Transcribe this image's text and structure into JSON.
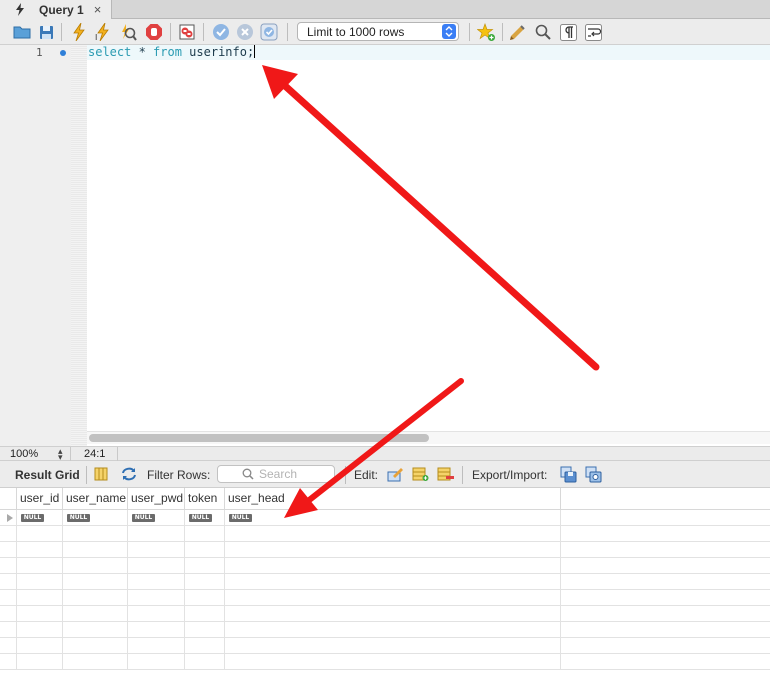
{
  "tab": {
    "title": "Query 1",
    "close_label": "×"
  },
  "toolbar": {
    "icons": [
      "open-folder-icon",
      "save-icon",
      "execute-icon",
      "execute-current-icon",
      "explain-icon",
      "stop-icon",
      "toggle-error-stop-icon",
      "commit-icon",
      "rollback-icon",
      "autocommit-icon",
      "bookmark-icon",
      "beautify-icon",
      "find-icon",
      "invisible-chars-icon",
      "word-wrap-icon"
    ],
    "limit_label": "Limit to 1000 rows"
  },
  "editor": {
    "line_number": "1",
    "tokens": {
      "select": "select",
      "star": " * ",
      "from": "from",
      "table": " userinfo;"
    },
    "colors": {
      "keyword": "#2a9bb2",
      "identifier": "#1d3b4c"
    }
  },
  "status": {
    "zoom": "100%",
    "cursor_position": "24:1"
  },
  "result_toolbar": {
    "result_grid_label": "Result Grid",
    "filter_rows_label": "Filter Rows:",
    "search_placeholder": "Search",
    "edit_label": "Edit:",
    "export_import_label": "Export/Import:"
  },
  "grid": {
    "columns": [
      "user_id",
      "user_name",
      "user_pwd",
      "token",
      "user_head"
    ],
    "null_label": "NULL"
  },
  "annotation": {
    "arrow_color": "#f01818"
  }
}
